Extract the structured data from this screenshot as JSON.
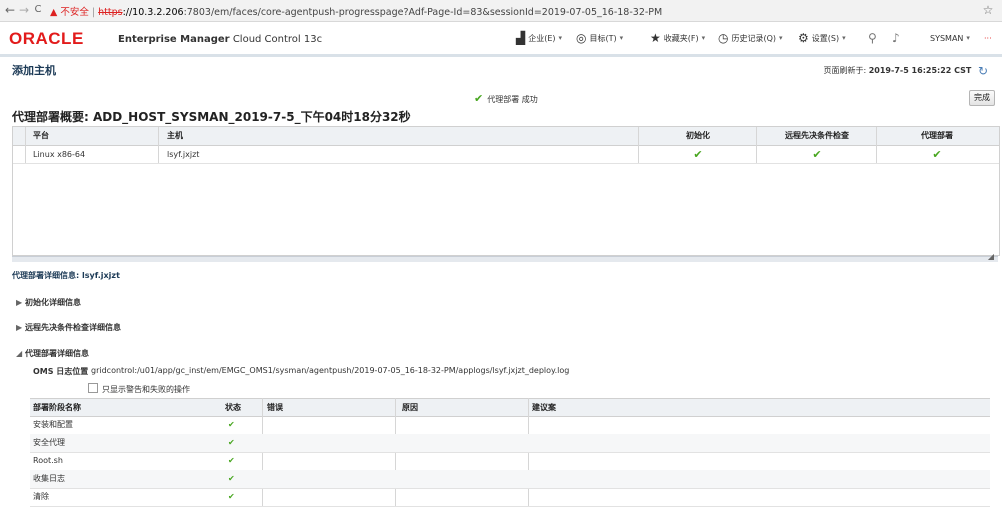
{
  "browser": {
    "back": "←",
    "forward": "→",
    "reload": "C",
    "warning_icon": "▲",
    "warning_text": "不安全",
    "separator": "|",
    "url_scheme": "https",
    "url_host": "://10.3.2.206",
    "url_rest": ":7803/em/faces/core-agentpush-progresspage?Adf-Page-Id=83&sessionId=2019-07-05_16-18-32-PM",
    "star": "☆"
  },
  "header": {
    "logo": "ORACLE",
    "product_bold": "Enterprise Manager",
    "product_rest": "Cloud Control 13c",
    "menus": {
      "enterprise": "企业(E)",
      "targets": "目标(T)",
      "favorites": "收藏夹(F)",
      "history": "历史记录(Q)",
      "settings": "设置(S)",
      "user": "SYSMAN",
      "more": "···"
    }
  },
  "page": {
    "title": "添加主机",
    "refresh_label": "页面刷新于:",
    "refresh_time": "2019-7-5 16:25:22 CST",
    "status": "代理部署 成功",
    "done_button": "完成",
    "summary_title": "代理部署概要: ADD_HOST_SYSMAN_2019-7-5_下午04时18分32秒"
  },
  "summary_table": {
    "headers": {
      "platform": "平台",
      "host": "主机",
      "init": "初始化",
      "prereq": "远程先决条件检查",
      "deploy": "代理部署"
    },
    "rows": [
      {
        "platform": "Linux x86-64",
        "host": "lsyf.jxjzt",
        "init": "✔",
        "prereq": "✔",
        "deploy": "✔"
      }
    ]
  },
  "details": {
    "title": "代理部署详细信息: lsyf.jxjzt",
    "sections": {
      "init": "初始化详细信息",
      "prereq": "远程先决条件检查详细信息",
      "deploy": "代理部署详细信息"
    },
    "collapsed_glyph": "▶",
    "expanded_glyph": "◢",
    "oms_label": "OMS 日志位置",
    "oms_path": "gridcontrol:/u01/app/gc_inst/em/EMGC_OMS1/sysman/agentpush/2019-07-05_16-18-32-PM/applogs/lsyf.jxjzt_deploy.log",
    "only_warn_label": "只显示警告和失败的操作"
  },
  "phase_table": {
    "headers": {
      "name": "部署阶段名称",
      "status": "状态",
      "error": "错误",
      "cause": "原因",
      "advice": "建议案"
    },
    "rows": [
      {
        "name": "安装和配置",
        "status": "✔"
      },
      {
        "name": "安全代理",
        "status": "✔"
      },
      {
        "name": "Root.sh",
        "status": "✔"
      },
      {
        "name": "收集日志",
        "status": "✔"
      },
      {
        "name": "清除",
        "status": "✔"
      }
    ]
  }
}
